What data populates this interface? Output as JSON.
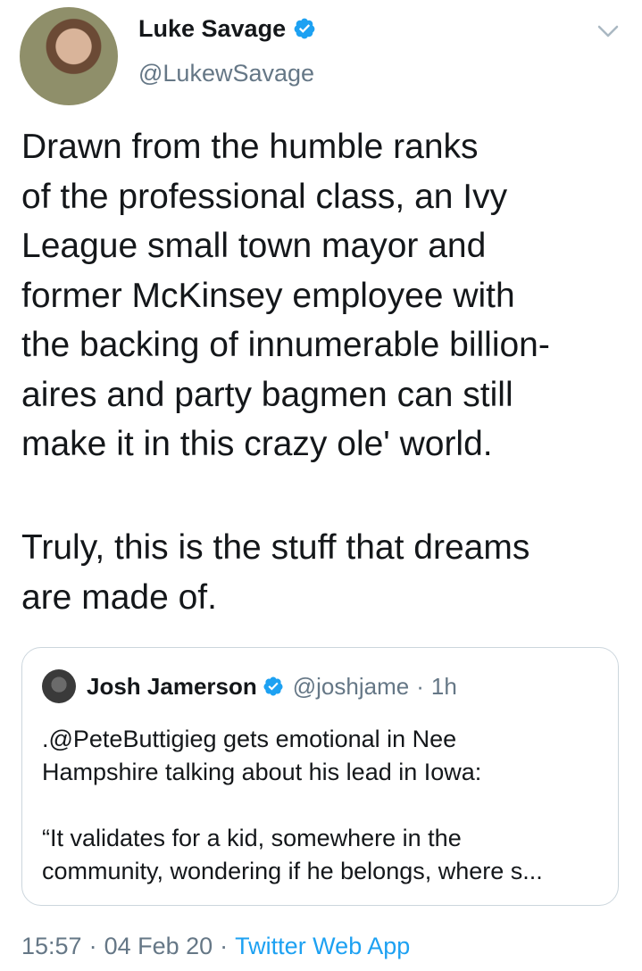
{
  "author": {
    "name": "Luke Savage",
    "handle": "@LukewSavage",
    "verified": true
  },
  "tweet": {
    "paragraph1": "Drawn from the humble ranks\nof the professional class, an Ivy\nLeague small town mayor and\nformer McKinsey employee with\nthe backing of innumerable billion-\naires and party bagmen can still\nmake it in this crazy ole' world.",
    "paragraph2": "Truly, this is the stuff that dreams\nare made of."
  },
  "quoted": {
    "name": "Josh Jamerson",
    "handle": "@joshjame",
    "separator": "·",
    "time": "1h",
    "text": ".@PeteButtigieg gets emotional in Nee\nHampshire talking about his lead in Iowa:\n\n“It validates for a kid, somewhere in the\ncommunity, wondering if he belongs, where s..."
  },
  "footer": {
    "time": "15:57",
    "separator": "·",
    "date": "04 Feb 20",
    "app": "Twitter Web App"
  },
  "colors": {
    "brand_blue": "#1da1f2",
    "secondary_text": "#657786",
    "border": "#ccd6dd"
  },
  "icons": {
    "verified": "verified-badge-icon",
    "menu": "chevron-down-icon"
  }
}
